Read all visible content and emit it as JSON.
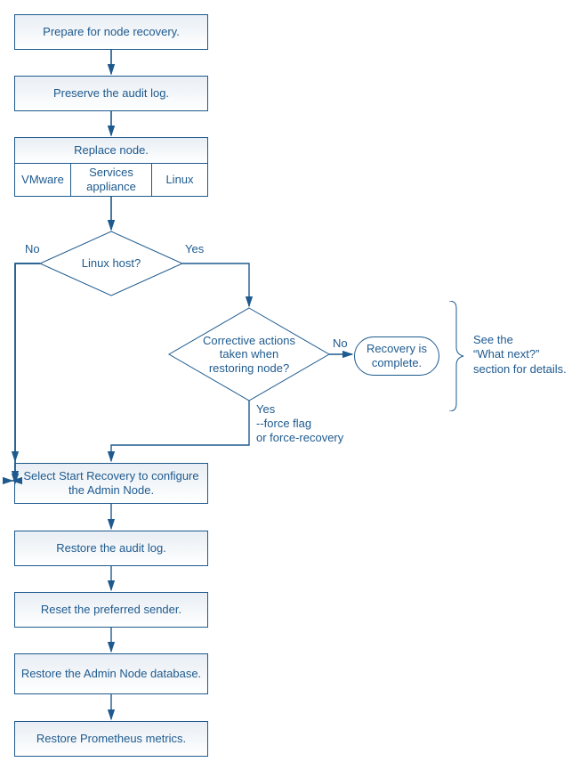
{
  "steps": {
    "prepare": "Prepare for node recovery.",
    "preserve": "Preserve the audit log.",
    "replace_header": "Replace node.",
    "replace_opts": {
      "vmware": "VMware",
      "services": "Services appliance",
      "linux": "Linux"
    },
    "start_recovery": "Select Start Recovery to configure the Admin Node.",
    "restore_audit": "Restore the audit log.",
    "reset_sender": "Reset the preferred sender.",
    "restore_db": "Restore the Admin Node database.",
    "restore_prom": "Restore Prometheus metrics."
  },
  "decisions": {
    "linux_host": "Linux host?",
    "corrective": "Corrective actions taken when restoring node?"
  },
  "terminator": {
    "complete": "Recovery is complete."
  },
  "labels": {
    "no": "No",
    "yes": "Yes",
    "force": "--force flag\nor force-recovery",
    "note": "See the\n“What next?”\nsection for details."
  }
}
